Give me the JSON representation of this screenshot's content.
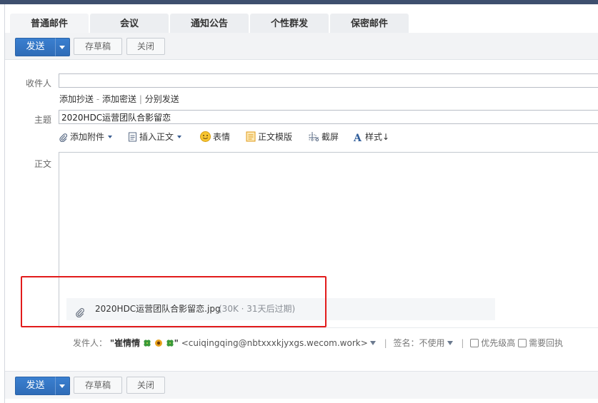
{
  "tabs": [
    {
      "label": "普通邮件",
      "active": true
    },
    {
      "label": "会议",
      "active": false
    },
    {
      "label": "通知公告",
      "active": false
    },
    {
      "label": "个性群发",
      "active": false
    },
    {
      "label": "保密邮件",
      "active": false
    }
  ],
  "toolbar": {
    "send_label": "发送",
    "draft_label": "存草稿",
    "close_label": "关闭"
  },
  "form": {
    "recipient_label": "收件人",
    "recipient_value": "",
    "add_cc": "添加抄送",
    "dash": "-",
    "add_bcc": "添加密送",
    "pipe": "|",
    "separate_send": "分别发送",
    "subject_label": "主题",
    "subject_value": "2020HDC运营团队合影留恋",
    "body_label": "正文"
  },
  "format_bar": {
    "add_attachment": "添加附件",
    "insert_body": "插入正文",
    "emoji": "表情",
    "template": "正文模版",
    "screenshot": "截屏",
    "style": "样式↓"
  },
  "attachment": {
    "filename": "2020HDC运营团队合影留恋.jpg",
    "meta": "(30K · 31天后过期)"
  },
  "sender": {
    "label": "发件人：",
    "quote_open": "\"",
    "name": "崔情情",
    "quote_close": "\"",
    "address": "<cuiqingqing@nbtxxxkjyxgs.wecom.work>",
    "signature_label": "签名：",
    "signature_value": "不使用",
    "high_priority": "优先级高",
    "need_receipt": "需要回执"
  },
  "colors": {
    "accent_blue": "#2f6cb8",
    "highlight_red": "#e21b1b"
  },
  "icons": [
    "paperclip-icon",
    "document-icon",
    "smiley-icon",
    "template-icon",
    "scissors-icon",
    "font-style-icon",
    "clover-icon",
    "flower-icon"
  ]
}
